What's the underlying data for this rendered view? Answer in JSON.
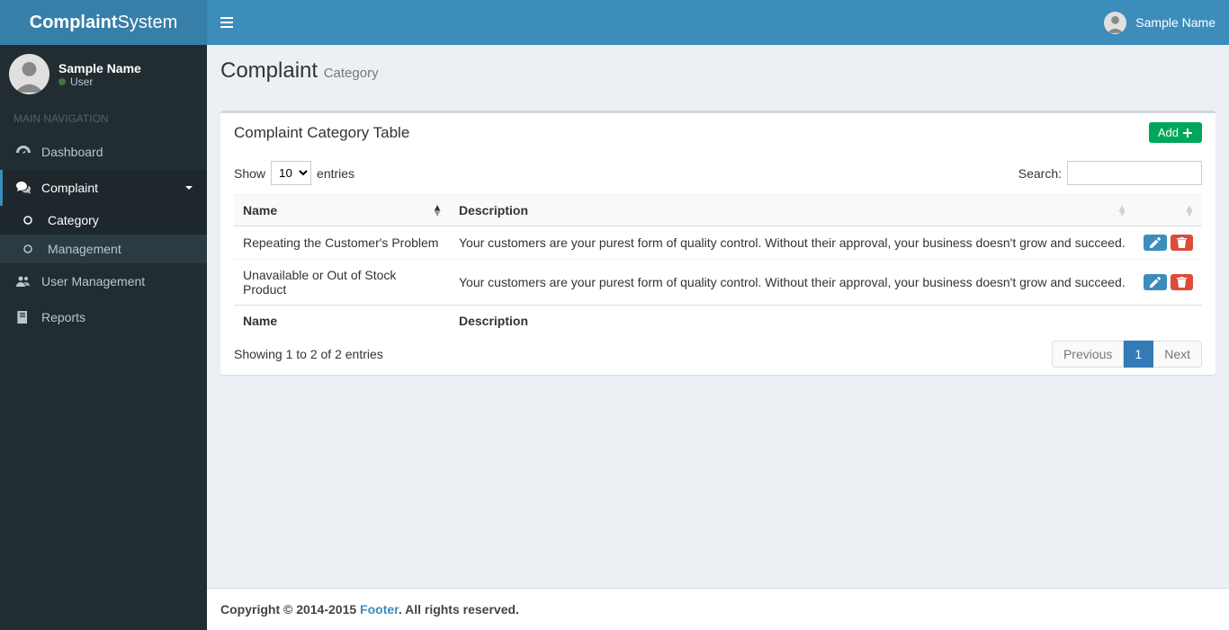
{
  "brand": {
    "bold": "Complaint",
    "light": "System"
  },
  "header_user": {
    "name": "Sample Name"
  },
  "sidebar": {
    "user": {
      "name": "Sample Name",
      "role": "User"
    },
    "header": "MAIN NAVIGATION",
    "items": [
      {
        "label": "Dashboard"
      },
      {
        "label": "Complaint"
      },
      {
        "label": "User Management"
      },
      {
        "label": "Reports"
      }
    ],
    "complaint_sub": [
      {
        "label": "Category"
      },
      {
        "label": "Management"
      }
    ]
  },
  "page": {
    "title": "Complaint",
    "subtitle": "Category"
  },
  "box": {
    "title": "Complaint Category Table",
    "add_label": "Add"
  },
  "table": {
    "show_label": "Show",
    "entries_label": "entries",
    "search_label": "Search:",
    "select_value": "10",
    "columns": {
      "name": "Name",
      "description": "Description"
    },
    "rows": [
      {
        "name": "Repeating the Customer's Problem",
        "description": "Your customers are your purest form of quality control. Without their approval, your business doesn't grow and succeed."
      },
      {
        "name": "Unavailable or Out of Stock Product",
        "description": "Your customers are your purest form of quality control. Without their approval, your business doesn't grow and succeed."
      }
    ],
    "info": "Showing 1 to 2 of 2 entries",
    "pagination": {
      "prev": "Previous",
      "current": "1",
      "next": "Next"
    }
  },
  "footer": {
    "copyright_pre": "Copyright © 2014-2015 ",
    "link": "Footer",
    "copyright_post": ". All rights reserved."
  }
}
